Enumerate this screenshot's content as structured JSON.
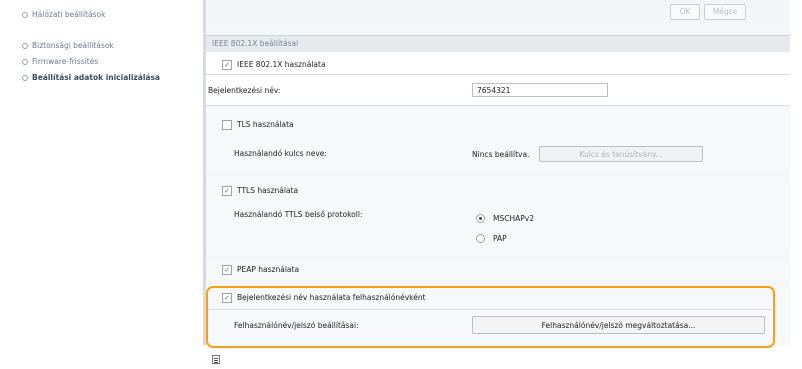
{
  "sidebar": {
    "items": [
      {
        "label": "Hálózati beállítások"
      },
      {
        "label": "Biztonsági beállítások"
      },
      {
        "label": "Firmware-frissítés"
      },
      {
        "label": "Beállítási adatok inicializálása"
      }
    ]
  },
  "toolbar": {
    "ok_label": "OK",
    "cancel_label": "Mégse"
  },
  "section": {
    "title": "IEEE 802.1X beállításai"
  },
  "ieee_use": {
    "label": "IEEE 802.1X használata",
    "checked": true
  },
  "login": {
    "label": "Bejelentkezési név:",
    "value": "7654321"
  },
  "tls": {
    "label": "TLS használata",
    "checked": false,
    "key_label": "Használandó kulcs neve:",
    "key_value": "Nincs beállítva.",
    "key_button": "Kulcs és tanúsítvány..."
  },
  "ttls": {
    "label": "TTLS használata",
    "checked": true,
    "protocol_label": "Használandó TTLS belső protokoll:",
    "options": [
      "MSCHAPv2",
      "PAP"
    ],
    "selected": "MSCHAPv2"
  },
  "peap": {
    "label": "PEAP használata",
    "checked": true
  },
  "username_login": {
    "label": "Bejelentkezési név használata felhasználónévként",
    "checked": true,
    "settings_label": "Felhasználónév/jelszó beállításai:",
    "change_button": "Felhasználónév/jelszó megváltoztatása..."
  },
  "colors": {
    "highlight": "#f4a21a",
    "section_bg": "#e7eaed"
  }
}
